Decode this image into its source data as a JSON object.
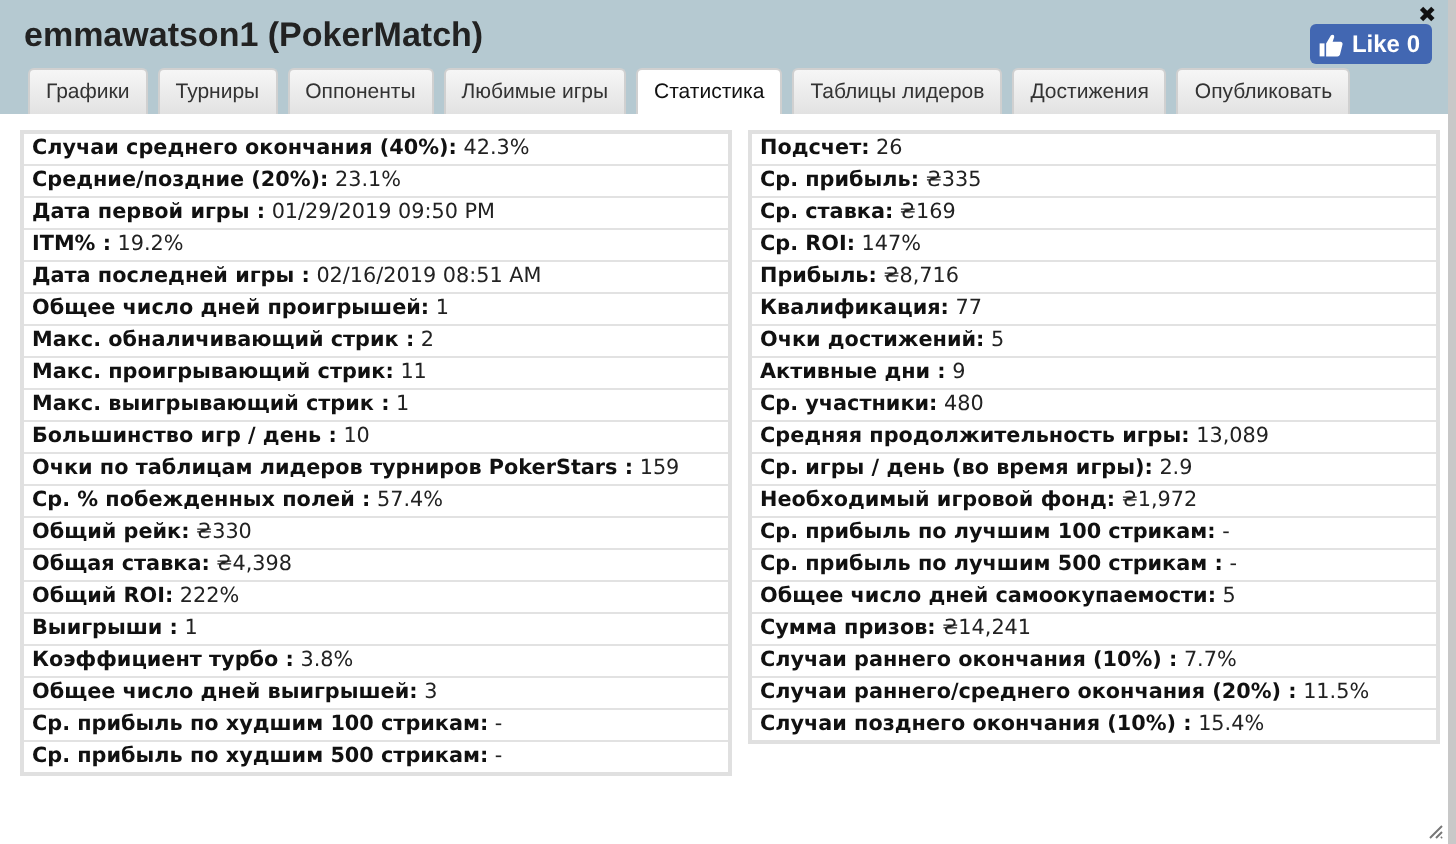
{
  "window": {
    "title": "emmawatson1 (PokerMatch)",
    "close": "✖"
  },
  "like_button": {
    "label": "Like 0"
  },
  "tabs": [
    {
      "label": "Графики",
      "selected": false
    },
    {
      "label": "Турниры",
      "selected": false
    },
    {
      "label": "Оппоненты",
      "selected": false
    },
    {
      "label": "Любимые игры",
      "selected": false
    },
    {
      "label": "Статистика",
      "selected": true
    },
    {
      "label": "Таблицы лидеров",
      "selected": false
    },
    {
      "label": "Достижения",
      "selected": false
    },
    {
      "label": "Опубликовать",
      "selected": false
    }
  ],
  "left_stats": [
    "**Случаи среднего окончания (40%):** 42.3%",
    "**Средние/поздние (20%):** 23.1%",
    "**Дата первой игры :** 01/29/2019 09:50 PM",
    "**ITM% :** 19.2%",
    "**Дата последней игры :** 02/16/2019 08:51 AM",
    "**Общее число дней проигрышей:** 1",
    "**Макс. обналичивающий стрик :** 2",
    "**Макс. проигрывающий стрик:** 11",
    "**Макс. выигрывающий стрик :** 1",
    "**Большинство игр / день :** 10",
    "**Очки по таблицам лидеров турниров PokerStars :** 159",
    "**Ср. % побежденных полей :** 57.4%",
    "**Общий рейк:** ₴330",
    "**Общая ставка:** ₴4,398",
    "**Общий ROI:** 222%",
    "**Выигрыши :** 1",
    "**Коэффициент турбо :** 3.8%",
    "**Общее число дней выигрышей:** 3",
    "**Ср. прибыль по худшим 100 стрикам:** -",
    "**Ср. прибыль по худшим 500 стрикам:** -"
  ],
  "right_stats": [
    "**Подсчет:** 26",
    "**Ср. прибыль:** ₴335",
    "**Ср. ставка:** ₴169",
    "**Ср. ROI:** 147%",
    "**Прибыль:** ₴8,716",
    "**Квалификация:** 77",
    "**Очки достижений:** 5",
    "**Активные дни :** 9",
    "**Ср. участники:** 480",
    "**Средняя продолжительность игры:** 13,089",
    "**Ср. игры / день (во время игры):** 2.9",
    "**Необходимый игровой фонд:** ₴1,972",
    "**Ср. прибыль по лучшим 100 стрикам:** -",
    "**Ср. прибыль по лучшим 500 стрикам :** -",
    "**Общее число дней самоокупаемости:** 5",
    "**Сумма призов:** ₴14,241",
    "**Случаи раннего окончания (10%) :** 7.7%",
    "**Случаи раннего/среднего окончания (20%) :** 11.5%",
    "**Случаи позднего окончания (10%) :** 15.4%"
  ]
}
